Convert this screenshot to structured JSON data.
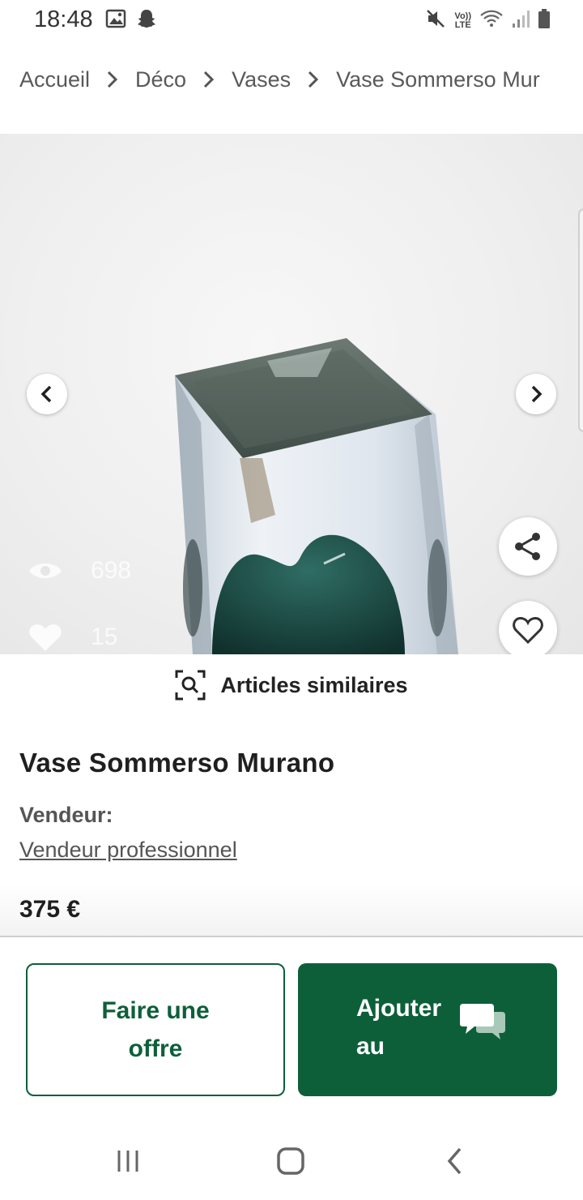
{
  "status_bar": {
    "time": "18:48",
    "icons": [
      "gallery-icon",
      "snapchat-icon",
      "mute-icon",
      "volte-icon",
      "wifi-icon",
      "signal-icon",
      "battery-icon"
    ],
    "lte_label_top": "Vo))",
    "lte_label_bottom": "LTE"
  },
  "breadcrumb": {
    "items": [
      "Accueil",
      "Déco",
      "Vases",
      "Vase Sommerso Mur"
    ]
  },
  "gallery": {
    "views": "698",
    "likes": "15"
  },
  "similar": {
    "label": "Articles similaires"
  },
  "product": {
    "title": "Vase Sommerso Murano",
    "seller_label": "Vendeur:",
    "seller_name": "Vendeur professionnel",
    "price": "375 €"
  },
  "actions": {
    "offer_label": "Faire une offre",
    "cart_label": "Ajouter au panier"
  },
  "colors": {
    "brand_green": "#0d5f3a",
    "breadcrumb_text": "#595959"
  }
}
